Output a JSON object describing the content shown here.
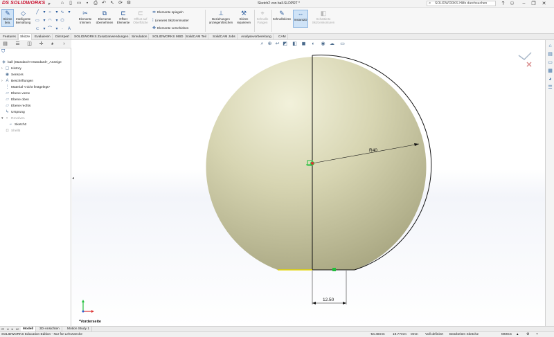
{
  "app": {
    "logo_brand": "DS",
    "logo_text": "SOLIDWORKS",
    "document_title": "Sketch2 von ball.SLDPRT *",
    "search_placeholder": "SOLIDWORKS Hilfe durchsuchen"
  },
  "ribbon": {
    "sketch_button": "Skizze bea.",
    "smart_dimension": "Intelligente Bemaßung",
    "trim": "Elemente trimmen",
    "convert": "Elemente übernehmen",
    "offset": "Offset Elemente",
    "offset_surface": "Offset auf Oberfläche",
    "mirror": "Elemente spiegeln",
    "linear_pattern": "Lineares Skizzenmuster",
    "move": "Elemente verschieben",
    "relations": "Beziehungen anzeigen/löschen",
    "repair": "Skizze reparieren",
    "quick_snaps": "Schnelle Fangen",
    "rapid_sketch": "Schnellskizze",
    "instant2d": "Instant2D",
    "shaded_contours": "Schattierte Skizzenkonturen"
  },
  "tabs": [
    "Features",
    "Skizze",
    "Evaluieren",
    "DimXpert",
    "SOLIDWORKS Zusatzanwendungen",
    "Simulation",
    "SOLIDWORKS MBD",
    "SolidCAM Teil",
    "SolidCAM Jobs",
    "Analysevorbereitung",
    "CAM"
  ],
  "active_tab": "Skizze",
  "tree": {
    "root": "ball  (Standard<<Standard>_Anzeige",
    "items": [
      "History",
      "Sensors",
      "Beschriftungen",
      "Material <nicht festgelegt>",
      "Ebene vorne",
      "Ebene oben",
      "Ebene rechts",
      "Ursprung",
      "Revolve1",
      "Sketch2",
      "Shell5"
    ]
  },
  "sketch": {
    "dim_radius": "R40",
    "dim_width": "12.50",
    "view_name": "*Vorderseite"
  },
  "bottom_tabs": [
    "Modell",
    "3D-Ansichten",
    "Motion Study 1"
  ],
  "status": {
    "edition": "SOLIDWORKS Education Edition - Nur für Lehrzwecke",
    "x": "-54.48mm",
    "y": "19.77mm",
    "z": "0mm",
    "state": "Voll definiert",
    "editing": "Bearbeiten Sketch2",
    "units": "MMGS"
  },
  "colors": {
    "sphere": "#d7d5b2",
    "accent": "#2a5b9c",
    "brand": "#c8102e",
    "relation_green": "#1fbf3a"
  }
}
